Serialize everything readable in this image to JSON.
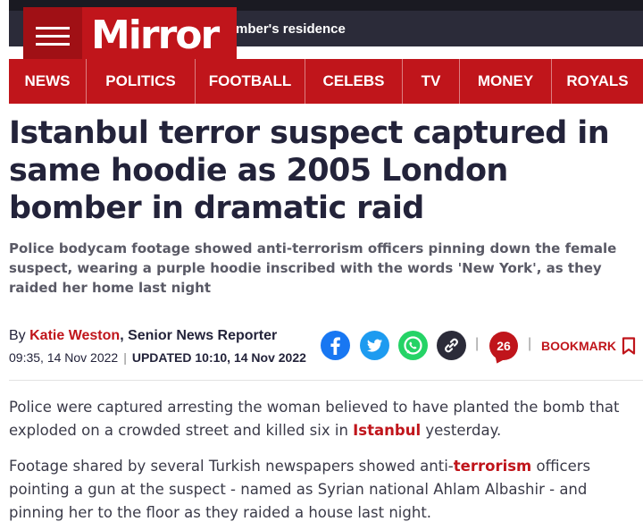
{
  "header": {
    "ticker_text": "mber's residence",
    "logo_text": "Mirror",
    "brand_color": "#c0151b"
  },
  "nav": {
    "items": [
      "NEWS",
      "POLITICS",
      "FOOTBALL",
      "CELEBS",
      "TV",
      "MONEY",
      "ROYALS"
    ]
  },
  "article": {
    "headline": "Istanbul terror suspect captured in same hoodie as 2005 London bomber in dramatic raid",
    "standfirst": "Police bodycam footage showed anti-terrorism officers pinning down the female suspect, wearing a purple hoodie inscribed with the words 'New York', as they raided her home last night",
    "byline": {
      "prefix": "By ",
      "author": "Katie Weston",
      "role": ", Senior News Reporter",
      "published": "09:35, 14 Nov 2022",
      "separator": "|",
      "updated": "UPDATED 10:10, 14 Nov 2022"
    },
    "share": {
      "icons": [
        "facebook-icon",
        "twitter-icon",
        "whatsapp-icon",
        "link-icon"
      ],
      "comment_count": "26",
      "bookmark_label": "BOOKMARK"
    },
    "paragraphs": [
      {
        "before": "Police were captured arresting the woman believed to have planted the bomb that exploded on a crowded street and killed six in ",
        "link": "Istanbul",
        "after": " yesterday."
      },
      {
        "before": "Footage shared by several Turkish newspapers showed anti-",
        "link": "terrorism",
        "after": " officers pointing a gun at the suspect - named as Syrian national Ahlam Albashir - and pinning her to the floor as they raided a house last night."
      }
    ]
  }
}
